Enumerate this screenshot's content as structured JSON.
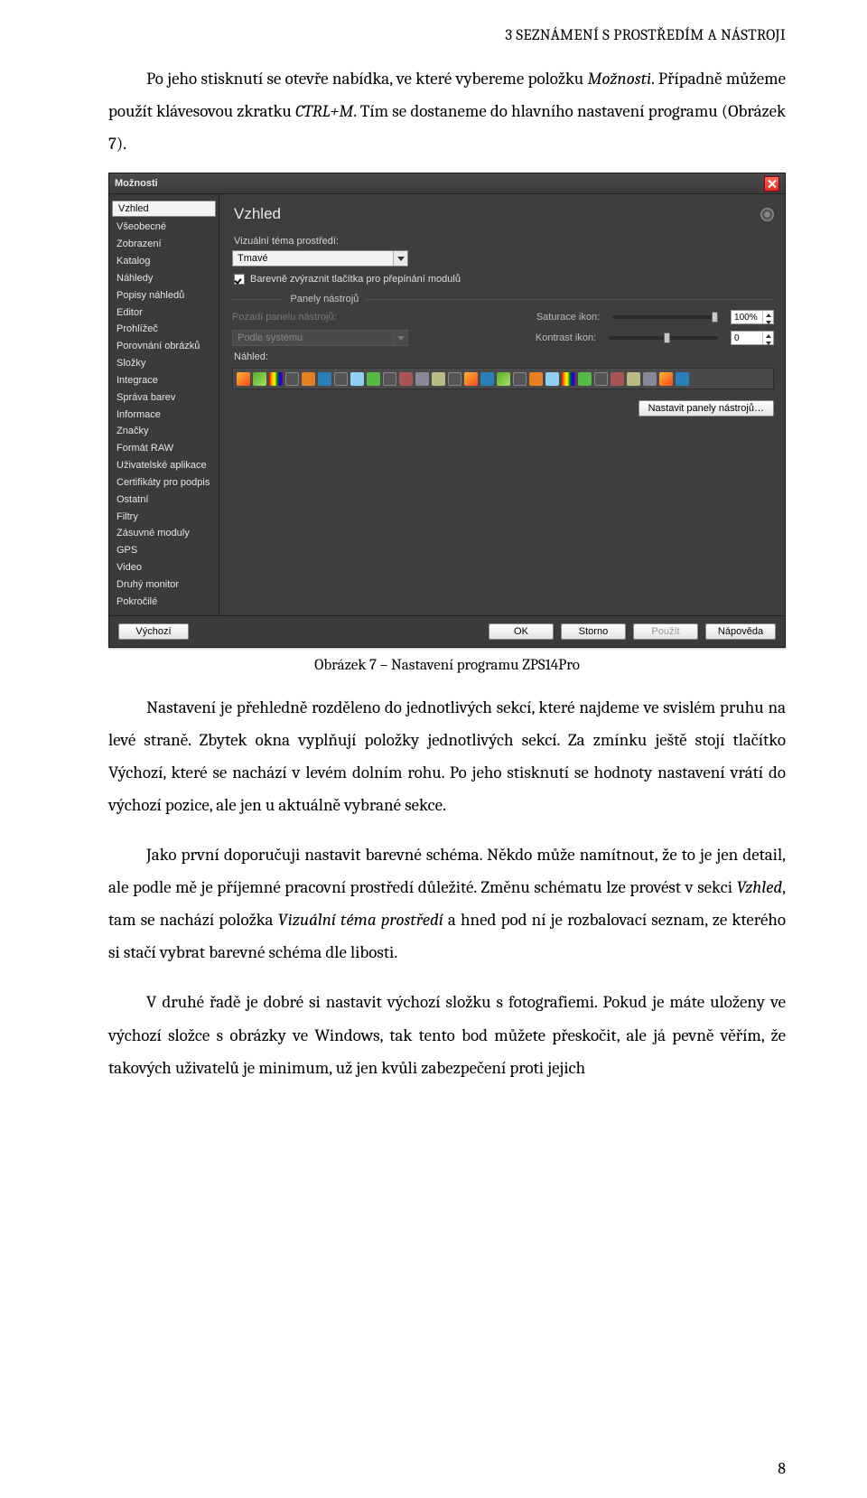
{
  "header": "3 SEZNÁMENÍ S PROSTŘEDÍM A NÁSTROJI",
  "para1_a": "Po jeho stisknutí se otevře nabídka, ve které vybereme položku ",
  "para1_i1": "Možnosti",
  "para1_b": ". Případně můžeme použít klávesovou zkratku ",
  "para1_i2": "CTRL+M",
  "para1_c": ". Tím se dostaneme do hlavního nastavení programu (Obrázek 7).",
  "caption": "Obrázek 7 – Nastavení programu ZPS14Pro",
  "para2": "Nastavení je přehledně rozděleno do jednotlivých sekcí, které najdeme ve svislém pruhu na levé straně. Zbytek okna vyplňují položky jednotlivých sekcí. Za zmínku ještě stojí tlačítko Výchozí, které se nachází v levém dolním rohu. Po jeho stisknutí se hodnoty nastavení vrátí do výchozí pozice, ale jen u aktuálně vybrané sekce.",
  "para3_a": "Jako první doporučuji nastavit barevné schéma. Někdo může namítnout, že to je jen detail, ale podle mě je příjemné pracovní prostředí důležité. Změnu schématu lze provést v sekci ",
  "para3_i1": "Vzhled",
  "para3_b": ", tam se nachází položka ",
  "para3_i2": "Vizuální téma prostředí",
  "para3_c": " a hned pod ní je rozbalovací seznam, ze kterého si stačí vybrat barevné schéma dle libosti.",
  "para4": "V druhé řadě je dobré si nastavit výchozí složku s fotografiemi. Pokud je máte uloženy ve výchozí složce s obrázky ve Windows, tak tento bod můžete přeskočit, ale já pevně věřím, že takových uživatelů je minimum, už jen kvůli zabezpečení proti jejich",
  "page_number": "8",
  "dialog": {
    "title": "Možnosti",
    "sidebar": {
      "selected": "Vzhled",
      "items": [
        "Všeobecné",
        "Zobrazení",
        "Katalog",
        "Náhledy",
        "Popisy náhledů",
        "Editor",
        "Prohlížeč",
        "Porovnání obrázků",
        "Složky",
        "Integrace",
        "Správa barev",
        "Informace",
        "Značky",
        "Formát RAW",
        "Uživatelské aplikace",
        "Certifikáty pro podpis",
        "Ostatní",
        "Filtry",
        "Zásuvné moduly",
        "GPS",
        "Video",
        "Druhý monitor",
        "Pokročilé"
      ]
    },
    "main": {
      "heading": "Vzhled",
      "theme_label": "Vizuální téma prostředí:",
      "theme_value": "Tmavé",
      "checkbox_label": "Barevně zvýraznit tlačítka pro přepínání modulů",
      "section_toolbars": "Panely nástrojů",
      "bg_label": "Pozadí panelu nástrojů:",
      "bg_value": "Podle systému",
      "saturation_label": "Saturace ikon:",
      "saturation_value": "100%",
      "contrast_label": "Kontrast ikon:",
      "contrast_value": "0",
      "preview_label": "Náhled:",
      "set_toolbars_btn": "Nastavit panely nástrojů…"
    },
    "footer": {
      "default": "Výchozí",
      "ok": "OK",
      "cancel": "Storno",
      "apply": "Použít",
      "help": "Nápověda"
    }
  }
}
